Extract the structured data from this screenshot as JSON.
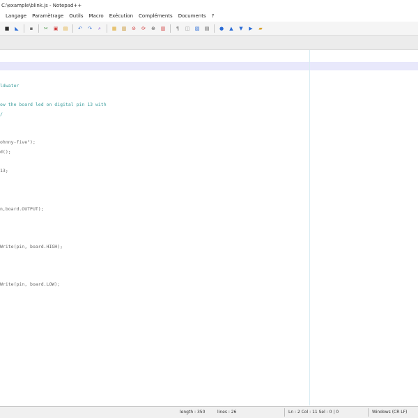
{
  "window": {
    "title": "C:\\example\\blink.js - Notepad++"
  },
  "menu": {
    "items": [
      "Langage",
      "Paramètrage",
      "Outils",
      "Macro",
      "Exécution",
      "Compléments",
      "Documents",
      "?"
    ]
  },
  "toolbar": {
    "icons": [
      {
        "name": "save-all-icon",
        "glyph": "■",
        "color": "#2b2b2b"
      },
      {
        "name": "close-icon",
        "glyph": "◣",
        "color": "#2b6cd6"
      },
      {
        "name": "print-icon",
        "glyph": "▪",
        "color": "#6a6a6a"
      },
      {
        "name": "cut-icon",
        "glyph": "✂",
        "color": "#3c8f3c"
      },
      {
        "name": "copy-icon",
        "glyph": "▣",
        "color": "#d13b3b"
      },
      {
        "name": "paste-icon",
        "glyph": "▤",
        "color": "#e0a82c"
      },
      {
        "name": "undo-icon",
        "glyph": "↶",
        "color": "#2b6cd6"
      },
      {
        "name": "redo-icon",
        "glyph": "↷",
        "color": "#2b6cd6"
      },
      {
        "name": "find-icon",
        "glyph": "⌕",
        "color": "#7a4bd6"
      },
      {
        "name": "replace-icon",
        "glyph": "▦",
        "color": "#e0a82c"
      },
      {
        "name": "zoom-in-icon",
        "glyph": "▥",
        "color": "#c58b1c"
      },
      {
        "name": "zoom-out-icon",
        "glyph": "⊘",
        "color": "#d13b3b"
      },
      {
        "name": "sync-icon",
        "glyph": "⟳",
        "color": "#d13b3b"
      },
      {
        "name": "wrap-icon",
        "glyph": "⊕",
        "color": "#555555"
      },
      {
        "name": "indent-guide-icon",
        "glyph": "▥",
        "color": "#d13b3b"
      },
      {
        "name": "all-chars-icon",
        "glyph": "¶",
        "color": "#8a8a8a"
      },
      {
        "name": "fold-icon",
        "glyph": "◫",
        "color": "#9a9a9a"
      },
      {
        "name": "unfold-icon",
        "glyph": "▧",
        "color": "#2b6cd6"
      },
      {
        "name": "doc-map-icon",
        "glyph": "▤",
        "color": "#555555"
      },
      {
        "name": "record-macro-icon",
        "glyph": "●",
        "color": "#2b6cd6"
      },
      {
        "name": "stop-macro-icon",
        "glyph": "▲",
        "color": "#2b6cd6"
      },
      {
        "name": "play-macro-icon",
        "glyph": "▼",
        "color": "#2b6cd6"
      },
      {
        "name": "run-macro-icon",
        "glyph": "▶",
        "color": "#2b6cd6"
      },
      {
        "name": "save-macro-icon",
        "glyph": "▰",
        "color": "#d8a02a"
      }
    ]
  },
  "editor": {
    "lines": [
      {
        "text": "",
        "kind": "code"
      },
      {
        "text": "",
        "kind": "code"
      },
      {
        "text": "",
        "kind": "code"
      },
      {
        "text": "ldwater",
        "kind": "cmt"
      },
      {
        "text": "",
        "kind": "code"
      },
      {
        "text": "ow the board led on digital pin 13 with",
        "kind": "cmt"
      },
      {
        "text": "/",
        "kind": "cmt"
      },
      {
        "text": "",
        "kind": "code"
      },
      {
        "text": "",
        "kind": "code"
      },
      {
        "text": "ohnny-five\");",
        "kind": "code"
      },
      {
        "text": "d();",
        "kind": "code"
      },
      {
        "text": "",
        "kind": "code"
      },
      {
        "text": "13;",
        "kind": "code"
      },
      {
        "text": "",
        "kind": "code"
      },
      {
        "text": "",
        "kind": "code"
      },
      {
        "text": "",
        "kind": "code"
      },
      {
        "text": "n,board.OUTPUT);",
        "kind": "code"
      },
      {
        "text": "",
        "kind": "code"
      },
      {
        "text": "",
        "kind": "code"
      },
      {
        "text": "",
        "kind": "code"
      },
      {
        "text": "Write(pin, board.HIGH);",
        "kind": "code"
      },
      {
        "text": "",
        "kind": "code"
      },
      {
        "text": "",
        "kind": "code"
      },
      {
        "text": "",
        "kind": "code"
      },
      {
        "text": "Write(pin, board.LOW);",
        "kind": "code"
      }
    ]
  },
  "status": {
    "length": "length : 350",
    "lines": "lines : 26",
    "position": "Ln : 2    Col : 11    Sel : 0 | 0",
    "eol": "Windows (CR LF)"
  }
}
